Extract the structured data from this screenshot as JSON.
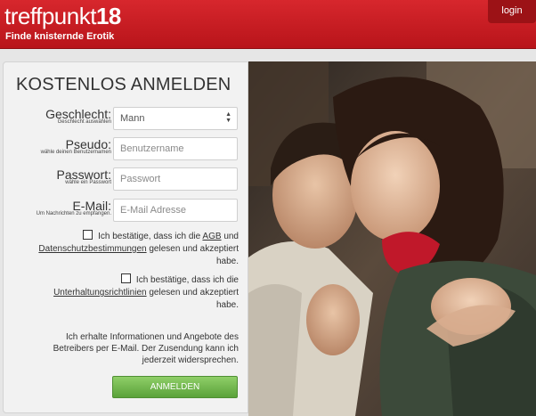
{
  "header": {
    "logo_text": "treffpunkt",
    "logo_number": "18",
    "tagline": "Finde knisternde Erotik",
    "login_label": "login",
    "brand_color": "#c81e24"
  },
  "form": {
    "title": "KOSTENLOS ANMELDEN",
    "gender": {
      "label": "Geschlecht:",
      "sublabel": "Geschlecht auswählen",
      "value": "Mann"
    },
    "pseudo": {
      "label": "Pseudo:",
      "sublabel": "wähle deinen Benutzernamen",
      "placeholder": "Benutzername"
    },
    "password": {
      "label": "Passwort:",
      "sublabel": "wähle ein Passwort",
      "placeholder": "Passwort"
    },
    "email": {
      "label": "E-Mail:",
      "sublabel": "Um Nachrichten zu empfangen.",
      "placeholder": "E-Mail Adresse"
    },
    "consent1": {
      "text_before": "Ich bestätige, dass ich die",
      "link1": "AGB",
      "text_mid": "und",
      "link2": "Datenschutzbestimmungen",
      "text_after": "gelesen und akzeptiert habe."
    },
    "consent2": {
      "text_before": "Ich bestätige, dass ich die",
      "link": "Unterhaltungsrichtlinien",
      "text_after": "gelesen und akzeptiert habe."
    },
    "info": "Ich erhalte Informationen und Angebote des Betreibers per E-Mail. Der Zusendung kann ich jederzeit widersprechen.",
    "submit_label": "ANMELDEN",
    "submit_color": "#6db447"
  },
  "photo": {
    "subject": "couple-embracing"
  }
}
